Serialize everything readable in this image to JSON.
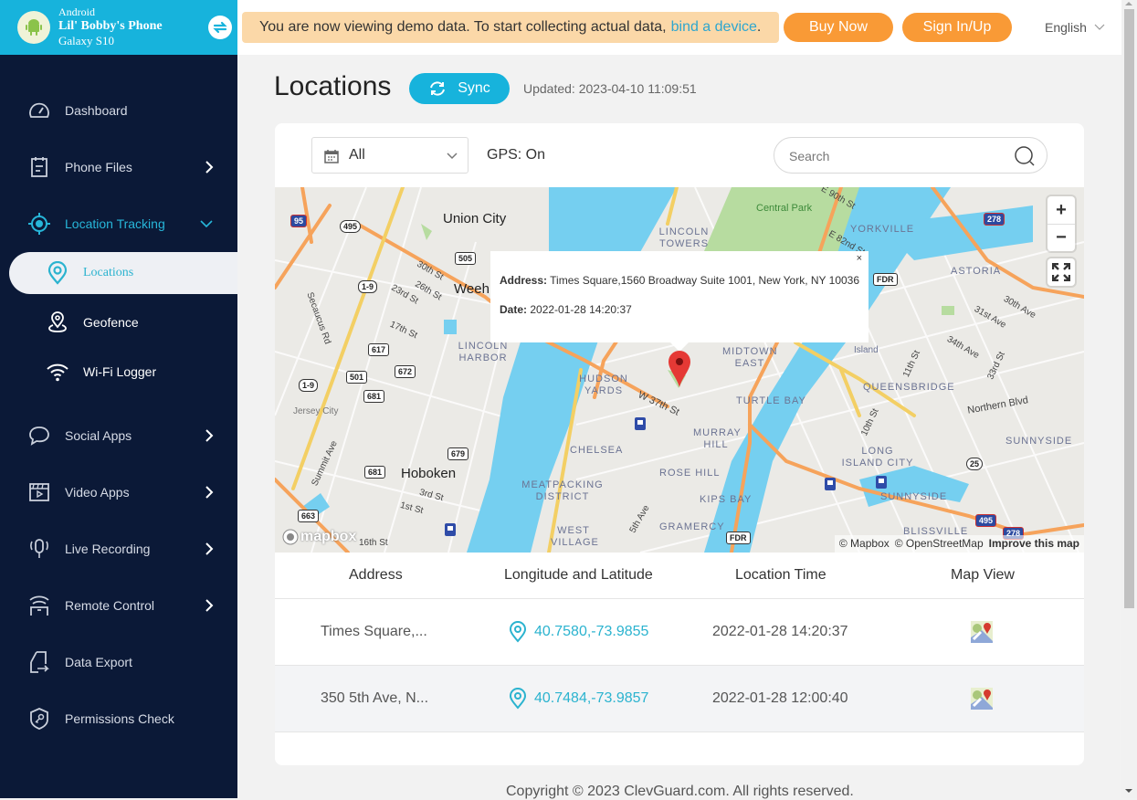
{
  "device": {
    "os": "Android",
    "name": "Lil' Bobby's Phone",
    "model": "Galaxy S10"
  },
  "topbar": {
    "banner_text": "You are now viewing demo data. To start collecting actual data,",
    "banner_link": "bind a device",
    "banner_end": ".",
    "buy_now": "Buy Now",
    "sign_in": "Sign In/Up",
    "language": "English"
  },
  "sidebar": {
    "items": [
      {
        "label": "Dashboard",
        "icon": "dashboard-icon"
      },
      {
        "label": "Phone Files",
        "icon": "phone-files-icon",
        "chevron": "right"
      },
      {
        "label": "Location Tracking",
        "icon": "location-tracking-icon",
        "chevron": "down",
        "active": true
      },
      {
        "label": "Social Apps",
        "icon": "chat-bubble-icon",
        "chevron": "right"
      },
      {
        "label": "Video Apps",
        "icon": "video-icon",
        "chevron": "right"
      },
      {
        "label": "Live Recording",
        "icon": "microphone-icon",
        "chevron": "right"
      },
      {
        "label": "Remote Control",
        "icon": "remote-control-icon",
        "chevron": "right"
      },
      {
        "label": "Data Export",
        "icon": "export-icon"
      },
      {
        "label": "Permissions Check",
        "icon": "shield-key-icon"
      }
    ],
    "sub_items": [
      {
        "label": "Locations",
        "icon": "location-pin-icon",
        "selected": true
      },
      {
        "label": "Geofence",
        "icon": "geofence-icon"
      },
      {
        "label": "Wi-Fi Logger",
        "icon": "wifi-icon"
      }
    ]
  },
  "main": {
    "title": "Locations",
    "sync_label": "Sync",
    "updated": "Updated: 2023-04-10 11:09:51",
    "filter_value": "All",
    "gps_status": "GPS: On",
    "search_placeholder": "Search"
  },
  "map": {
    "popup": {
      "address_label": "Address:",
      "address": "Times Square,1560 Broadway Suite 1001, New York, NY 10036",
      "date_label": "Date:",
      "date": "2022-01-28 14:20:37",
      "close": "×"
    },
    "labels": {
      "union_city": "Union City",
      "weehawken": "Weeh",
      "hoboken": "Hoboken",
      "jersey_city": "Jersey City",
      "central_park": "Central Park",
      "yorkville": "YORKVILLE",
      "lincoln_towers": "LINCOLN TOWERS",
      "lincoln_harbor": "LINCOLN HARBOR",
      "hudson_yards": "HUDSON YARDS",
      "midtown_east": "MIDTOWN EAST",
      "turtle_bay": "TURTLE BAY",
      "murray_hill": "MURRAY HILL",
      "rose_hill": "ROSE HILL",
      "kips_bay": "KIPS BAY",
      "chelsea": "CHELSEA",
      "meatpacking": "MEATPACKING DISTRICT",
      "west_village": "WEST VILLAGE",
      "gramercy": "GRAMERCY",
      "astoria": "ASTORIA",
      "queensbridge": "QUEENSBRIDGE",
      "long_island_city": "LONG ISLAND CITY",
      "sunnyside1": "SUNNYSIDE",
      "sunnyside2": "SUNNYSIDE",
      "blissville": "BLISSVILLE",
      "roosevelt_island": "Island",
      "northern_blvd": "Northern Blvd",
      "w37": "W 37th St",
      "st30": "30th St",
      "st26": "26th St",
      "st23": "23rd St",
      "st17": "17th St",
      "st3": "3rd St",
      "st1": "1st St",
      "st16": "16th St",
      "secaucus": "Secaucus Rd",
      "summit": "Summit Ave",
      "e90": "E 90th St",
      "e82": "E 82nd St",
      "ave30": "30th Ave",
      "ave31": "31st Ave",
      "ave34": "34th Ave",
      "st11": "11th St",
      "st10": "10th St",
      "st33": "33rd St",
      "fifth": "5th Ave"
    },
    "shields": [
      "95",
      "495",
      "505",
      "1-9",
      "617",
      "501",
      "672",
      "681",
      "1-9",
      "681",
      "679",
      "663",
      "FDR",
      "FDR",
      "278",
      "25",
      "495",
      "278"
    ],
    "zoom_in": "+",
    "zoom_out": "−",
    "mapbox_logo": "mapbox",
    "attribution": [
      "© Mapbox",
      "© OpenStreetMap"
    ],
    "improve": "Improve this map"
  },
  "table": {
    "headers": [
      "Address",
      "Longitude and Latitude",
      "Location Time",
      "Map View"
    ],
    "rows": [
      {
        "address": "Times Square,...",
        "coords": "40.7580,-73.9855",
        "time": "2022-01-28 14:20:37"
      },
      {
        "address": "350 5th Ave, N...",
        "coords": "40.7484,-73.9857",
        "time": "2022-01-28 12:00:40"
      }
    ]
  },
  "footer": {
    "copyright": "Copyright © 2023 ClevGuard.com. All rights reserved."
  },
  "colors": {
    "accent": "#17b3dc",
    "sidebar_bg": "#0b1937",
    "orange": "#f99a36",
    "banner_bg": "#fbd8a8",
    "link": "#2bb3cf",
    "water": "#75cff0",
    "park": "#b7dca0"
  }
}
